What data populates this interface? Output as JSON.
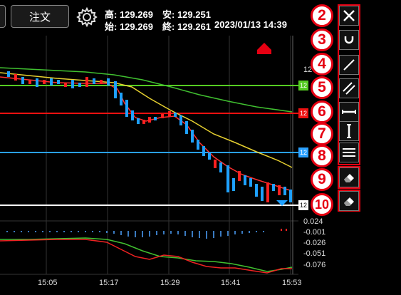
{
  "header": {
    "order_button": "注文",
    "high": "高: 129.269",
    "low": "安: 129.251",
    "open": "始: 129.269",
    "close": "終: 129.261",
    "datetime": "2023/01/13 14:39"
  },
  "tools": [
    {
      "number": "2",
      "icon": "close-icon"
    },
    {
      "number": "3",
      "icon": "magnet-icon"
    },
    {
      "number": "4",
      "icon": "trendline-icon"
    },
    {
      "number": "5",
      "icon": "parallel-lines-icon"
    },
    {
      "number": "6",
      "icon": "horizontal-line-icon"
    },
    {
      "number": "7",
      "icon": "vertical-line-icon"
    },
    {
      "number": "8",
      "icon": "multi-horizontal-lines-icon"
    },
    {
      "number": "9",
      "icon": "eraser-icon"
    },
    {
      "number": "10",
      "icon": "eraser-all-icon"
    }
  ],
  "price_tags": [
    "12",
    "12",
    "12",
    "12",
    "12"
  ],
  "osc_axis": [
    "0.024",
    "-0.001",
    "-0.026",
    "-0.051",
    "-0.076"
  ],
  "x_axis": [
    "15:05",
    "15:17",
    "15:29",
    "15:41",
    "15:53"
  ],
  "colors": {
    "up": "#ff2020",
    "down": "#1ea0ff",
    "ma_fast": "#ff3030",
    "ma_mid": "#e6d030",
    "ma_slow": "#40c030",
    "line_green": "#55cc22",
    "line_red": "#ee1111",
    "line_blue": "#2aa0ff",
    "line_white": "#ffffff"
  }
}
